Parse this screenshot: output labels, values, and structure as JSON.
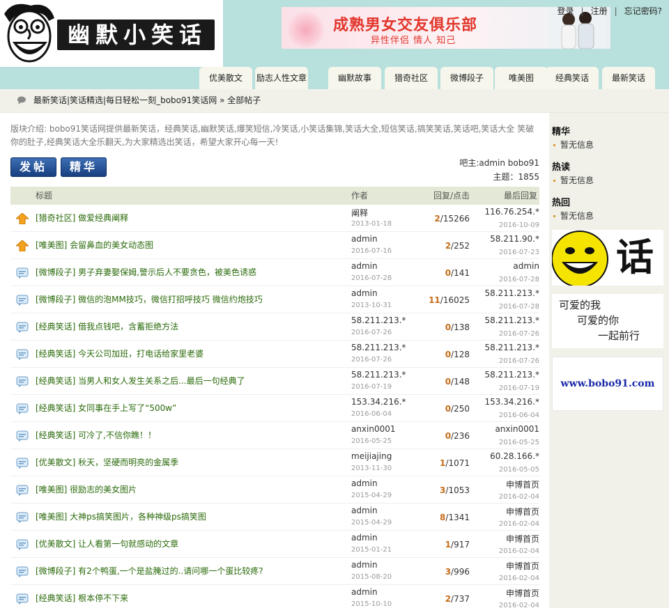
{
  "header": {
    "logo_text": "幽默小笑话",
    "banner_title": "成熟男女交友俱乐部",
    "banner_sub": "异性伴侣 情人 知己",
    "top_links": [
      "登录",
      "注册",
      "忘记密码?"
    ]
  },
  "nav": [
    "优美散文",
    "励志人性文章",
    "幽默故事",
    "猎奇社区",
    "微博段子",
    "唯美图",
    "经典笑话",
    "最新笑话"
  ],
  "breadcrumb": {
    "site": "最新笑话|笑话精选|每日轻松一刻_bobo91笑话网",
    "sep": "»",
    "current": "全部帖子"
  },
  "intro": "版块介绍: bobo91笑话网提供最新笑话，经典笑话,幽默笑话,爆笑短信,冷笑话,小笑话集锦,笑话大全,短信笑话,搞笑笑话,笑话吧,笑话大全 笑破你的肚子,经典笑话大全乐翻天,为大家精选出笑话，希望大家开心每一天!",
  "buttons": {
    "post": "发帖",
    "elite": "精华"
  },
  "owner": {
    "line1": "吧主:admin bobo91",
    "line2": "主题：1855"
  },
  "table": {
    "headers": {
      "title": "标题",
      "author": "作者",
      "stats": "回复/点击",
      "last": "最后回复"
    },
    "rows": [
      {
        "icon": "top",
        "title": "[猎奇社区] 做爱经典阐释",
        "author": "阐释",
        "adate": "2013-01-18",
        "replies": "2",
        "views": "/15266",
        "last": "116.76.254.*",
        "ldate": "2016-10-09"
      },
      {
        "icon": "top",
        "title": "[唯美图] 会留鼻血的美女动态图",
        "author": "admin",
        "adate": "2016-07-16",
        "replies": "2",
        "views": "/252",
        "last": "58.211.90.*",
        "ldate": "2016-07-23"
      },
      {
        "icon": "normal",
        "title": "[微博段子] 男子弃妻娶保姆,警示后人不要贪色，被美色诱惑",
        "author": "admin",
        "adate": "2016-07-28",
        "replies": "0",
        "views": "/141",
        "last": "admin",
        "ldate": "2016-07-28"
      },
      {
        "icon": "normal",
        "title": "[微博段子] 微信的泡MM技巧，微信打招呼技巧 微信约炮技巧",
        "author": "admin",
        "adate": "2013-10-31",
        "replies": "11",
        "views": "/16025",
        "last": "58.211.213.*",
        "ldate": "2016-07-28"
      },
      {
        "icon": "normal",
        "title": "[经典笑话] 借我点钱吧，含蓄拒绝方法",
        "author": "58.211.213.*",
        "adate": "2016-07-26",
        "replies": "0",
        "views": "/138",
        "last": "58.211.213.*",
        "ldate": "2016-07-26"
      },
      {
        "icon": "normal",
        "title": "[经典笑话] 今天公司加班，打电话给家里老婆",
        "author": "58.211.213.*",
        "adate": "2016-07-26",
        "replies": "0",
        "views": "/128",
        "last": "58.211.213.*",
        "ldate": "2016-07-26"
      },
      {
        "icon": "normal",
        "title": "[经典笑话] 当男人和女人发生关系之后...最后一句经典了",
        "author": "58.211.213.*",
        "adate": "2016-07-19",
        "replies": "0",
        "views": "/148",
        "last": "58.211.213.*",
        "ldate": "2016-07-19"
      },
      {
        "icon": "normal",
        "title": "[经典笑话] 女同事在手上写了“500w”",
        "author": "153.34.216.*",
        "adate": "2016-06-04",
        "replies": "0",
        "views": "/250",
        "last": "153.34.216.*",
        "ldate": "2016-06-04"
      },
      {
        "icon": "normal",
        "title": "[经典笑话] 可冷了,不信你瞧！！",
        "author": "anxin0001",
        "adate": "2016-05-25",
        "replies": "0",
        "views": "/236",
        "last": "anxin0001",
        "ldate": "2016-05-25"
      },
      {
        "icon": "normal",
        "title": "[优美散文] 秋天，坚硬而明亮的金属季",
        "author": "meijiajing",
        "adate": "2013-11-30",
        "replies": "1",
        "views": "/1071",
        "last": "60.28.166.*",
        "ldate": "2016-05-05"
      },
      {
        "icon": "normal",
        "title": "[唯美图] 很励志的美女图片",
        "author": "admin",
        "adate": "2015-04-29",
        "replies": "3",
        "views": "/1053",
        "last": "申博首页",
        "ldate": "2016-02-04"
      },
      {
        "icon": "normal",
        "title": "[唯美图] 大神ps搞笑图片，各种神级ps搞笑图",
        "author": "admin",
        "adate": "2015-04-29",
        "replies": "8",
        "views": "/1341",
        "last": "申博首页",
        "ldate": "2016-02-04"
      },
      {
        "icon": "normal",
        "title": "[优美散文] 让人看第一句就感动的文章",
        "author": "admin",
        "adate": "2015-01-21",
        "replies": "1",
        "views": "/917",
        "last": "申博首页",
        "ldate": "2016-02-04"
      },
      {
        "icon": "normal",
        "title": "[微博段子] 有2个鸭蛋,一个是盐腌过的..请问哪一个蛋比较疼?",
        "author": "admin",
        "adate": "2015-08-20",
        "replies": "3",
        "views": "/996",
        "last": "申博首页",
        "ldate": "2016-02-04"
      },
      {
        "icon": "normal",
        "title": "[经典笑话] 根本停不下来",
        "author": "admin",
        "adate": "2015-10-10",
        "replies": "2",
        "views": "/737",
        "last": "申博首页",
        "ldate": "2016-02-04"
      }
    ]
  },
  "sidebar": {
    "sections": [
      {
        "title": "精华",
        "item": "暂无信息"
      },
      {
        "title": "热读",
        "item": "暂无信息"
      },
      {
        "title": "热回",
        "item": "暂无信息"
      }
    ],
    "ad1_text": "话",
    "ad2_lines": [
      "可爱的我",
      "可爱的你",
      "一起前行"
    ],
    "ad3_text": "www.bobo91.com"
  },
  "colors": {
    "accent_teal": "#b8e0dc",
    "title_green": "#2a6a0a",
    "reply_orange": "#c66c18",
    "button_blue": "#1f4a8e"
  }
}
